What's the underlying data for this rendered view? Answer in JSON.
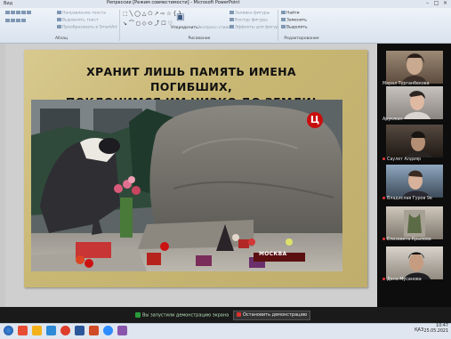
{
  "window": {
    "title": "Репрессии [Режим совместимости] - Microsoft PowerPoint",
    "menu": "Вид"
  },
  "ribbon": {
    "groups": [
      {
        "label": "Абзац",
        "items": [
          "Направление текста",
          "Выровнять текст",
          "Преобразовать в SmartArt"
        ]
      },
      {
        "label": "Рисование",
        "items": [
          "Упорядочить",
          "Экспресс-стили",
          "Заливка фигуры",
          "Контур фигуры",
          "Эффекты для фигур"
        ]
      },
      {
        "label": "Редактирование",
        "items": [
          "Найти",
          "Заменить",
          "Выделить"
        ]
      }
    ]
  },
  "slide": {
    "title_line1": "ХРАНИТ ЛИШЬ ПАМЯТЬ ИМЕНА ПОГИБШИХ,",
    "title_line2": "ПОКЛОНИМСЯ ИМ НИЗКО ДО ЗЕМЛИ!",
    "channel_logo": "Ц",
    "caption": "МОСКВА"
  },
  "participants": [
    {
      "name": "Марал Турганбекова",
      "muted": false
    },
    {
      "name": "Арукжан",
      "muted": false
    },
    {
      "name": "Саулет Алдияр",
      "muted": true
    },
    {
      "name": "Владислав Гуров 9е",
      "muted": true
    },
    {
      "name": "Елизавета Крылова",
      "muted": true
    },
    {
      "name": "Дана Мусанова",
      "muted": true
    }
  ],
  "share_bar": {
    "status": "Вы запустили демонстрацию экрана",
    "stop_label": "Остановить демонстрацию"
  },
  "taskbar": {
    "lang": "ҚАЗ",
    "time": "10:47",
    "date": "25.05.2021"
  }
}
